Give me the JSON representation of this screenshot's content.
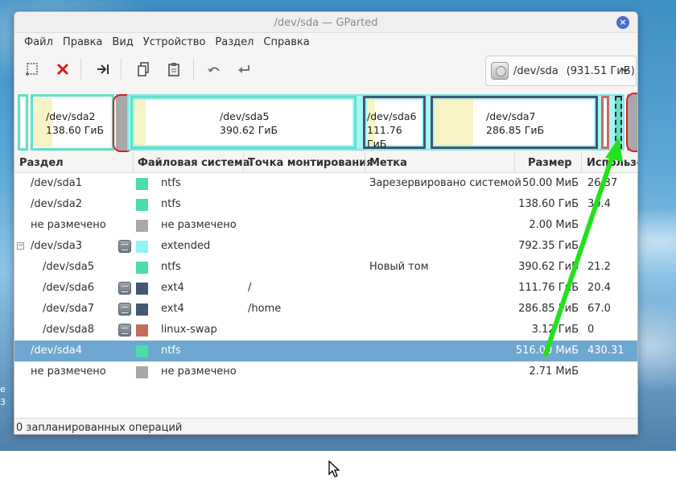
{
  "desktop": {
    "side_text_1": "e",
    "side_text_2": "3"
  },
  "window": {
    "title": "/dev/sda — GParted",
    "close_glyph": "×"
  },
  "menu": [
    "Файл",
    "Правка",
    "Вид",
    "Устройство",
    "Раздел",
    "Справка"
  ],
  "device_selector": {
    "device": "/dev/sda",
    "size": "(931.51 ГиБ)"
  },
  "disk_map": [
    {
      "name": "/dev/sda2",
      "size": "138.60 ГиБ"
    },
    {
      "name": "/dev/sda5",
      "size": "390.62 ГиБ"
    },
    {
      "name": "/dev/sda6",
      "size": "111.76 ГиБ"
    },
    {
      "name": "/dev/sda7",
      "size": "286.85 ГиБ"
    }
  ],
  "table": {
    "headers": [
      "Раздел",
      "Файловая система",
      "Точка монтирования",
      "Метка",
      "Размер",
      "Использовано"
    ],
    "rows": [
      {
        "partition": "/dev/sda1",
        "fs": "ntfs",
        "mount": "",
        "label": "Зарезервировано системой",
        "size": "50.00 МиБ",
        "used": "26.37",
        "color": "#4cdda8",
        "lock": false,
        "indent": false,
        "selected": false
      },
      {
        "partition": "/dev/sda2",
        "fs": "ntfs",
        "mount": "",
        "label": "",
        "size": "138.60 ГиБ",
        "used": "30.4",
        "color": "#4cdda8",
        "lock": false,
        "indent": false,
        "selected": false
      },
      {
        "partition": "не размечено",
        "fs": "не размечено",
        "mount": "",
        "label": "",
        "size": "2.00 МиБ",
        "used": "",
        "color": "#a8a8a8",
        "lock": false,
        "indent": false,
        "selected": false
      },
      {
        "partition": "/dev/sda3",
        "fs": "extended",
        "mount": "",
        "label": "",
        "size": "792.35 ГиБ",
        "used": "",
        "color": "#8ff5f5",
        "lock": true,
        "indent": false,
        "selected": false,
        "expander": "−"
      },
      {
        "partition": "/dev/sda5",
        "fs": "ntfs",
        "mount": "",
        "label": "Новый том",
        "size": "390.62 ГиБ",
        "used": "21.2",
        "color": "#4cdda8",
        "lock": false,
        "indent": true,
        "selected": false
      },
      {
        "partition": "/dev/sda6",
        "fs": "ext4",
        "mount": "/",
        "label": "",
        "size": "111.76 ГиБ",
        "used": "20.4",
        "color": "#42586f",
        "lock": true,
        "indent": true,
        "selected": false
      },
      {
        "partition": "/dev/sda7",
        "fs": "ext4",
        "mount": "/home",
        "label": "",
        "size": "286.85 ГиБ",
        "used": "67.0",
        "color": "#42586f",
        "lock": true,
        "indent": true,
        "selected": false
      },
      {
        "partition": "/dev/sda8",
        "fs": "linux-swap",
        "mount": "",
        "label": "",
        "size": "3.12 ГиБ",
        "used": "0",
        "color": "#c56a5f",
        "lock": true,
        "indent": true,
        "selected": false
      },
      {
        "partition": "/dev/sda4",
        "fs": "ntfs",
        "mount": "",
        "label": "",
        "size": "516.00 МиБ",
        "used": "430.31",
        "color": "#4cdda8",
        "lock": false,
        "indent": false,
        "selected": true
      },
      {
        "partition": "не размечено",
        "fs": "не размечено",
        "mount": "",
        "label": "",
        "size": "2.71 МиБ",
        "used": "",
        "color": "#a8a8a8",
        "lock": false,
        "indent": false,
        "selected": false
      }
    ]
  },
  "status": "0 запланированных операций",
  "colors": {
    "ntfs": "#4cdda8",
    "ext4": "#42586f",
    "swap": "#c56a5f",
    "unallocated": "#a8a8a8",
    "extended": "#8ff5f5",
    "selection": "#6ea7cf",
    "annotation_red": "#e21c24",
    "annotation_green": "#22e21c"
  }
}
